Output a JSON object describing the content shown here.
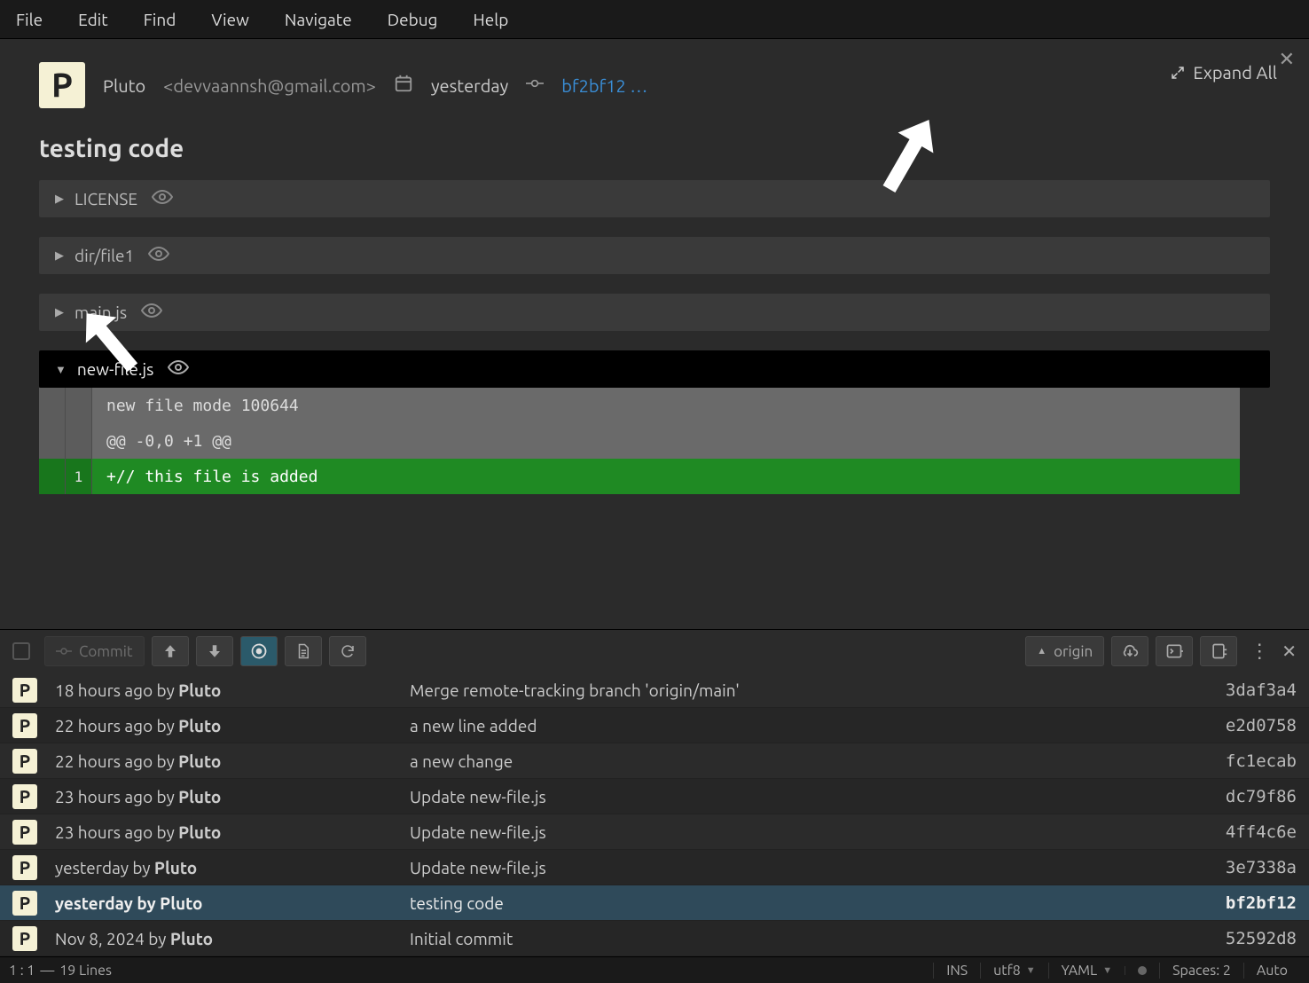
{
  "menu": [
    "File",
    "Edit",
    "Find",
    "View",
    "Navigate",
    "Debug",
    "Help"
  ],
  "detail": {
    "avatar_letter": "P",
    "author_name": "Pluto",
    "author_email": "<devvaannsh@gmail.com>",
    "date": "yesterday",
    "hash": "bf2bf12",
    "ellipsis": "…",
    "expand_all": "Expand All",
    "title": "testing code",
    "files": [
      {
        "name": "LICENSE",
        "expanded": false
      },
      {
        "name": "dir/file1",
        "expanded": false
      },
      {
        "name": "main.js",
        "expanded": false
      },
      {
        "name": "new-file.js",
        "expanded": true
      }
    ],
    "diff": {
      "mode_line": "new file mode 100644",
      "hunk_line": "@@ -0,0 +1 @@",
      "added_lineno": "1",
      "added_content": "+// this file is added"
    }
  },
  "toolbar": {
    "commit_label": "Commit",
    "origin_label": "origin"
  },
  "history": [
    {
      "when": "18 hours ago",
      "by": "Pluto",
      "msg": "Merge remote-tracking branch 'origin/main'",
      "hash": "3daf3a4",
      "selected": false
    },
    {
      "when": "22 hours ago",
      "by": "Pluto",
      "msg": "a new line added",
      "hash": "e2d0758",
      "selected": false
    },
    {
      "when": "22 hours ago",
      "by": "Pluto",
      "msg": "a new change",
      "hash": "fc1ecab",
      "selected": false
    },
    {
      "when": "23 hours ago",
      "by": "Pluto",
      "msg": "Update new-file.js",
      "hash": "dc79f86",
      "selected": false
    },
    {
      "when": "23 hours ago",
      "by": "Pluto",
      "msg": "Update new-file.js",
      "hash": "4ff4c6e",
      "selected": false
    },
    {
      "when": "yesterday",
      "by": "Pluto",
      "msg": "Update new-file.js",
      "hash": "3e7338a",
      "selected": false
    },
    {
      "when": "yesterday",
      "by": "Pluto",
      "msg": "testing code",
      "hash": "bf2bf12",
      "selected": true
    },
    {
      "when": "Nov 8, 2024",
      "by": "Pluto",
      "msg": "Initial commit",
      "hash": "52592d8",
      "selected": false
    }
  ],
  "status": {
    "pos": "1 : 1",
    "lines": "19 Lines",
    "ins": "INS",
    "encoding": "utf8",
    "lang": "YAML",
    "spaces": "Spaces: 2",
    "auto": "Auto"
  }
}
